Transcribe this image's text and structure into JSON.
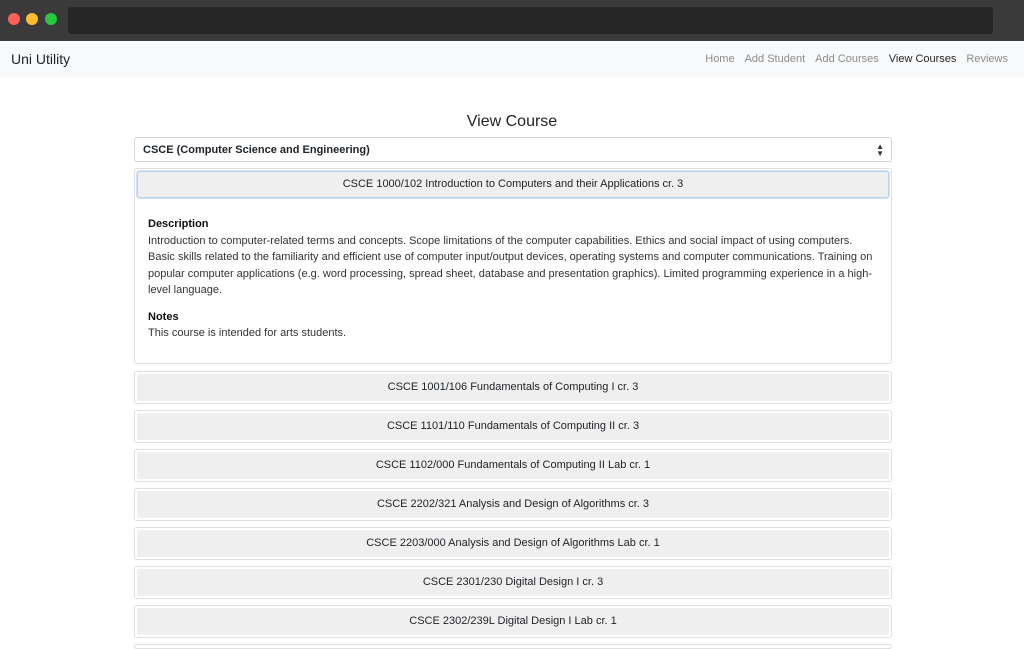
{
  "navbar": {
    "brand": "Uni Utility",
    "links": [
      "Home",
      "Add Student",
      "Add Courses",
      "View Courses",
      "Reviews"
    ],
    "active": "View Courses"
  },
  "page_title": "View Course",
  "department_select": {
    "value": "CSCE (Computer Science and Engineering)"
  },
  "courses": [
    {
      "title": "CSCE 1000/102 Introduction to Computers and their Applications cr. 3",
      "expanded": true,
      "description_label": "Description",
      "description": "Introduction to computer-related terms and concepts. Scope limitations of the computer capabilities. Ethics and social impact of using computers. Basic skills related to the familiarity and efficient use of computer input/output devices, operating systems and computer communications. Training on popular computer applications (e.g. word processing, spread sheet, database and presentation graphics). Limited programming experience in a high-level language.",
      "notes_label": "Notes",
      "notes": "This course is intended for arts students."
    },
    {
      "title": "CSCE 1001/106 Fundamentals of Computing I cr. 3"
    },
    {
      "title": "CSCE 1101/110 Fundamentals of Computing II cr. 3"
    },
    {
      "title": "CSCE 1102/000 Fundamentals of Computing II Lab cr. 1"
    },
    {
      "title": "CSCE 2202/321 Analysis and Design of Algorithms cr. 3"
    },
    {
      "title": "CSCE 2203/000 Analysis and Design of Algorithms Lab cr. 1"
    },
    {
      "title": "CSCE 2301/230 Digital Design I cr. 3"
    },
    {
      "title": "CSCE 2302/239L Digital Design I Lab cr. 1"
    }
  ],
  "colors": {
    "navbar_bg": "#f8f9fa",
    "accordion_bg": "#efefef",
    "focus_border": "#b8d2f0"
  }
}
